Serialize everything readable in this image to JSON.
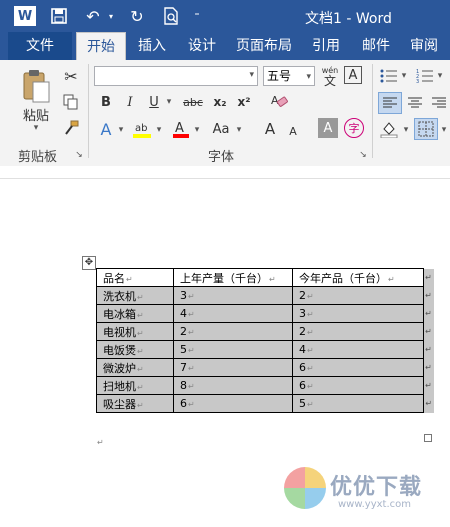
{
  "window": {
    "title": "文档1 - Word",
    "brand_color": "#2b579a",
    "quick_access": {
      "logo": "W",
      "save_icon": "save-icon",
      "undo_icon": "undo-icon",
      "redo_icon": "redo-icon",
      "preview_icon": "print-preview-icon",
      "customize_icon": "customize-qat-icon"
    }
  },
  "tabs": [
    {
      "label": "文件"
    },
    {
      "label": "开始"
    },
    {
      "label": "插入"
    },
    {
      "label": "设计"
    },
    {
      "label": "页面布局"
    },
    {
      "label": "引用"
    },
    {
      "label": "邮件"
    },
    {
      "label": "审阅"
    }
  ],
  "ribbon": {
    "clipboard": {
      "paste_label": "粘贴",
      "group_label": "剪贴板"
    },
    "font": {
      "font_name": "",
      "font_size": "五号",
      "phonetic_label": "wén",
      "phonetic_char": "文",
      "char_border": "A",
      "bold": "B",
      "italic": "I",
      "underline": "U",
      "strikethrough": "abc",
      "subscript": "x₂",
      "superscript": "x²",
      "text_effects": "A",
      "change_case": "Aa",
      "grow_font": "A",
      "shrink_font": "A",
      "char_shading": "A",
      "enclose_char": "字",
      "group_label": "字体",
      "highlight_color": "#ffff00",
      "font_color": "#ff0000"
    }
  },
  "table": {
    "headers": [
      "品名",
      "上年产量（千台）",
      "今年产品（千台）"
    ],
    "rows": [
      [
        "洗衣机",
        "3",
        "2"
      ],
      [
        "电冰箱",
        "4",
        "3"
      ],
      [
        "电视机",
        "2",
        "2"
      ],
      [
        "电饭煲",
        "5",
        "4"
      ],
      [
        "微波炉",
        "7",
        "6"
      ],
      [
        "扫地机",
        "8",
        "6"
      ],
      [
        "吸尘器",
        "6",
        "5"
      ]
    ],
    "selection_color": "#c8c8c8"
  },
  "watermark": {
    "text": "优优下载",
    "url": "www.yyxt.com"
  }
}
